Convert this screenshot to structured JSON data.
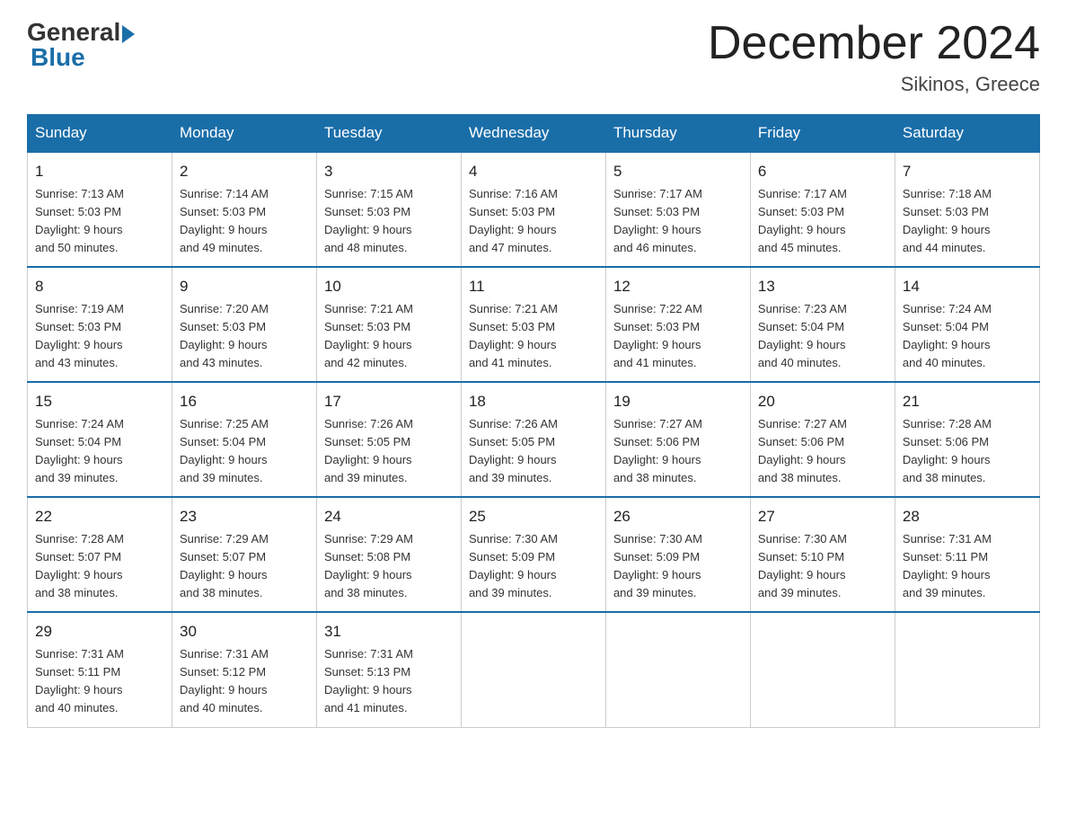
{
  "header": {
    "logo_general": "General",
    "logo_blue": "Blue",
    "month_title": "December 2024",
    "location": "Sikinos, Greece"
  },
  "days_of_week": [
    "Sunday",
    "Monday",
    "Tuesday",
    "Wednesday",
    "Thursday",
    "Friday",
    "Saturday"
  ],
  "weeks": [
    [
      {
        "day": "1",
        "sunrise": "7:13 AM",
        "sunset": "5:03 PM",
        "daylight": "9 hours and 50 minutes."
      },
      {
        "day": "2",
        "sunrise": "7:14 AM",
        "sunset": "5:03 PM",
        "daylight": "9 hours and 49 minutes."
      },
      {
        "day": "3",
        "sunrise": "7:15 AM",
        "sunset": "5:03 PM",
        "daylight": "9 hours and 48 minutes."
      },
      {
        "day": "4",
        "sunrise": "7:16 AM",
        "sunset": "5:03 PM",
        "daylight": "9 hours and 47 minutes."
      },
      {
        "day": "5",
        "sunrise": "7:17 AM",
        "sunset": "5:03 PM",
        "daylight": "9 hours and 46 minutes."
      },
      {
        "day": "6",
        "sunrise": "7:17 AM",
        "sunset": "5:03 PM",
        "daylight": "9 hours and 45 minutes."
      },
      {
        "day": "7",
        "sunrise": "7:18 AM",
        "sunset": "5:03 PM",
        "daylight": "9 hours and 44 minutes."
      }
    ],
    [
      {
        "day": "8",
        "sunrise": "7:19 AM",
        "sunset": "5:03 PM",
        "daylight": "9 hours and 43 minutes."
      },
      {
        "day": "9",
        "sunrise": "7:20 AM",
        "sunset": "5:03 PM",
        "daylight": "9 hours and 43 minutes."
      },
      {
        "day": "10",
        "sunrise": "7:21 AM",
        "sunset": "5:03 PM",
        "daylight": "9 hours and 42 minutes."
      },
      {
        "day": "11",
        "sunrise": "7:21 AM",
        "sunset": "5:03 PM",
        "daylight": "9 hours and 41 minutes."
      },
      {
        "day": "12",
        "sunrise": "7:22 AM",
        "sunset": "5:03 PM",
        "daylight": "9 hours and 41 minutes."
      },
      {
        "day": "13",
        "sunrise": "7:23 AM",
        "sunset": "5:04 PM",
        "daylight": "9 hours and 40 minutes."
      },
      {
        "day": "14",
        "sunrise": "7:24 AM",
        "sunset": "5:04 PM",
        "daylight": "9 hours and 40 minutes."
      }
    ],
    [
      {
        "day": "15",
        "sunrise": "7:24 AM",
        "sunset": "5:04 PM",
        "daylight": "9 hours and 39 minutes."
      },
      {
        "day": "16",
        "sunrise": "7:25 AM",
        "sunset": "5:04 PM",
        "daylight": "9 hours and 39 minutes."
      },
      {
        "day": "17",
        "sunrise": "7:26 AM",
        "sunset": "5:05 PM",
        "daylight": "9 hours and 39 minutes."
      },
      {
        "day": "18",
        "sunrise": "7:26 AM",
        "sunset": "5:05 PM",
        "daylight": "9 hours and 39 minutes."
      },
      {
        "day": "19",
        "sunrise": "7:27 AM",
        "sunset": "5:06 PM",
        "daylight": "9 hours and 38 minutes."
      },
      {
        "day": "20",
        "sunrise": "7:27 AM",
        "sunset": "5:06 PM",
        "daylight": "9 hours and 38 minutes."
      },
      {
        "day": "21",
        "sunrise": "7:28 AM",
        "sunset": "5:06 PM",
        "daylight": "9 hours and 38 minutes."
      }
    ],
    [
      {
        "day": "22",
        "sunrise": "7:28 AM",
        "sunset": "5:07 PM",
        "daylight": "9 hours and 38 minutes."
      },
      {
        "day": "23",
        "sunrise": "7:29 AM",
        "sunset": "5:07 PM",
        "daylight": "9 hours and 38 minutes."
      },
      {
        "day": "24",
        "sunrise": "7:29 AM",
        "sunset": "5:08 PM",
        "daylight": "9 hours and 38 minutes."
      },
      {
        "day": "25",
        "sunrise": "7:30 AM",
        "sunset": "5:09 PM",
        "daylight": "9 hours and 39 minutes."
      },
      {
        "day": "26",
        "sunrise": "7:30 AM",
        "sunset": "5:09 PM",
        "daylight": "9 hours and 39 minutes."
      },
      {
        "day": "27",
        "sunrise": "7:30 AM",
        "sunset": "5:10 PM",
        "daylight": "9 hours and 39 minutes."
      },
      {
        "day": "28",
        "sunrise": "7:31 AM",
        "sunset": "5:11 PM",
        "daylight": "9 hours and 39 minutes."
      }
    ],
    [
      {
        "day": "29",
        "sunrise": "7:31 AM",
        "sunset": "5:11 PM",
        "daylight": "9 hours and 40 minutes."
      },
      {
        "day": "30",
        "sunrise": "7:31 AM",
        "sunset": "5:12 PM",
        "daylight": "9 hours and 40 minutes."
      },
      {
        "day": "31",
        "sunrise": "7:31 AM",
        "sunset": "5:13 PM",
        "daylight": "9 hours and 41 minutes."
      },
      null,
      null,
      null,
      null
    ]
  ],
  "labels": {
    "sunrise": "Sunrise:",
    "sunset": "Sunset:",
    "daylight": "Daylight:"
  }
}
